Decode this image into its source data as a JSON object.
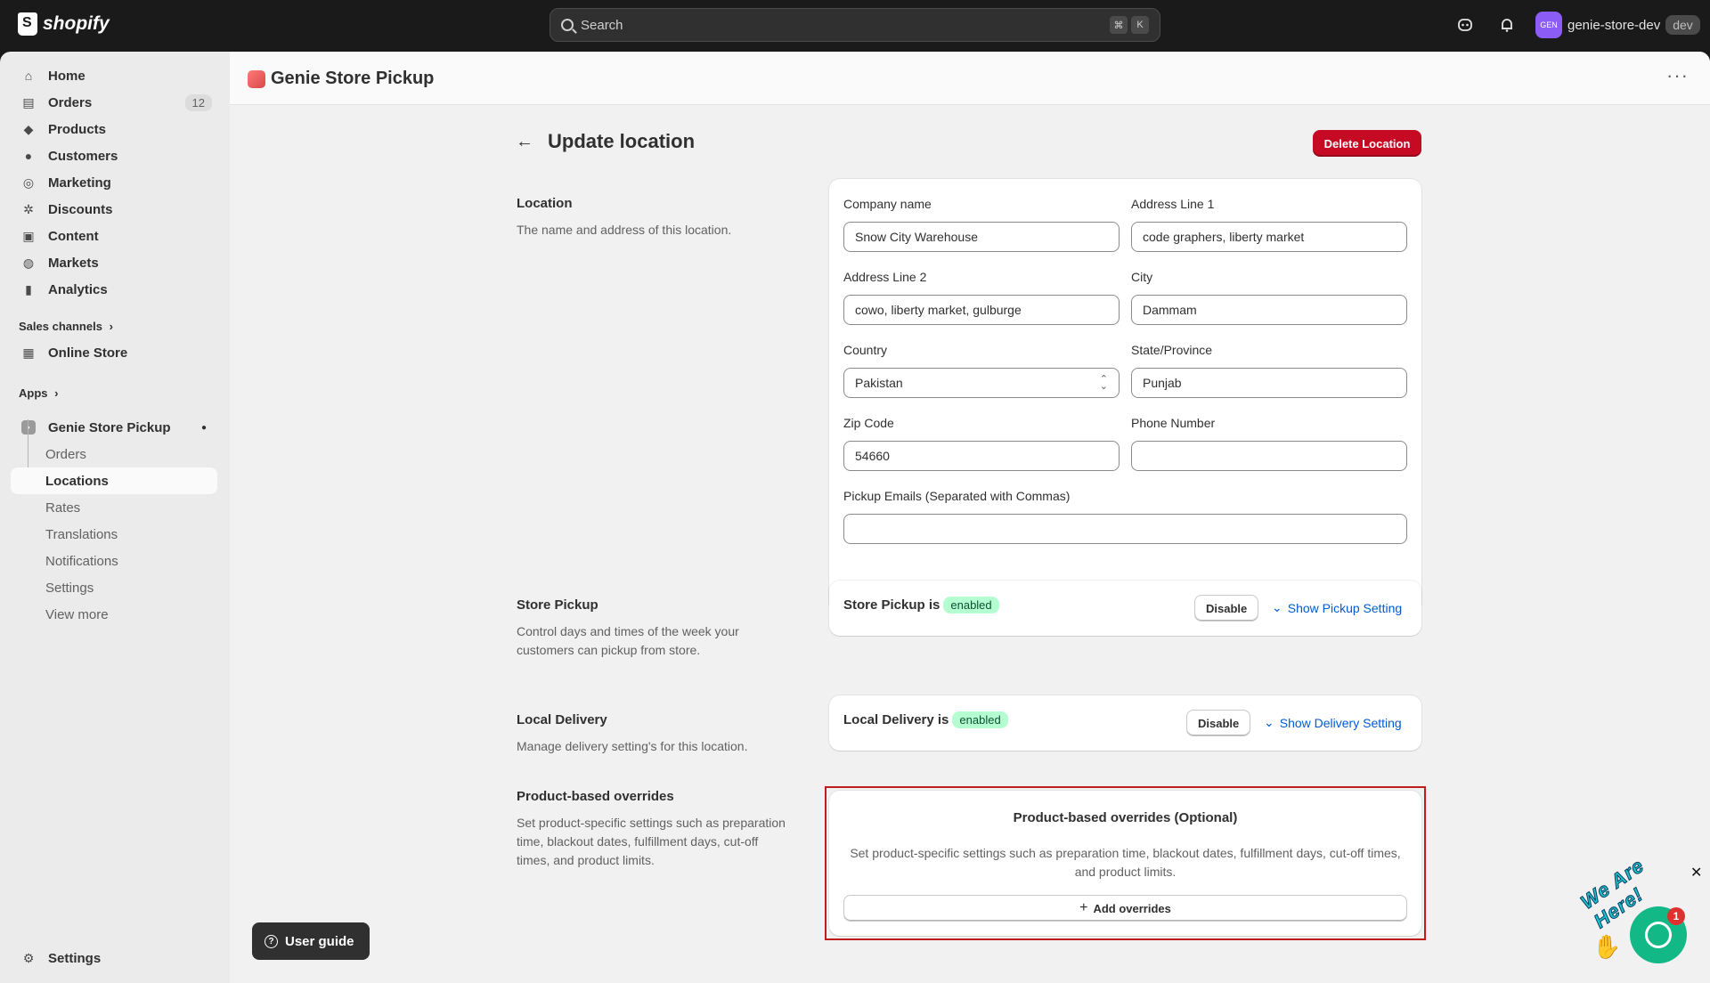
{
  "topbar": {
    "brand": "shopify",
    "search_placeholder": "Search",
    "shortcut_keys": [
      "⌘",
      "K"
    ],
    "store_avatar": "GEN",
    "store_name": "genie-store-dev",
    "store_tag": "dev"
  },
  "sidebar": {
    "items": [
      {
        "label": "Home",
        "icon": "home-icon"
      },
      {
        "label": "Orders",
        "icon": "orders-icon",
        "badge": "12"
      },
      {
        "label": "Products",
        "icon": "tag-icon"
      },
      {
        "label": "Customers",
        "icon": "person-icon"
      },
      {
        "label": "Marketing",
        "icon": "target-icon"
      },
      {
        "label": "Discounts",
        "icon": "discount-icon"
      },
      {
        "label": "Content",
        "icon": "content-icon"
      },
      {
        "label": "Markets",
        "icon": "globe-icon"
      },
      {
        "label": "Analytics",
        "icon": "bar-chart-icon"
      }
    ],
    "sales_channels_label": "Sales channels",
    "online_store": "Online Store",
    "apps_label": "Apps",
    "app_name": "Genie Store Pickup",
    "app_subitems": [
      "Orders",
      "Locations",
      "Rates",
      "Translations",
      "Notifications",
      "Settings",
      "View more"
    ],
    "active_subitem": "Locations",
    "settings": "Settings"
  },
  "app_header": {
    "title": "Genie Store Pickup",
    "more": "···"
  },
  "page": {
    "back_arrow": "←",
    "title": "Update location",
    "delete_button": "Delete Location"
  },
  "location_section": {
    "title": "Location",
    "description": "The name and address of this location.",
    "fields": {
      "company_name": {
        "label": "Company name",
        "value": "Snow City Warehouse"
      },
      "address1": {
        "label": "Address Line 1",
        "value": "code graphers, liberty market"
      },
      "address2": {
        "label": "Address Line 2",
        "value": "cowo, liberty market, gulburge"
      },
      "city": {
        "label": "City",
        "value": "Dammam"
      },
      "country": {
        "label": "Country",
        "value": "Pakistan"
      },
      "state": {
        "label": "State/Province",
        "value": "Punjab"
      },
      "zip": {
        "label": "Zip Code",
        "value": "54660"
      },
      "phone": {
        "label": "Phone Number",
        "value": ""
      },
      "pickup_emails": {
        "label": "Pickup Emails (Separated with Commas)",
        "value": ""
      }
    }
  },
  "store_pickup": {
    "title": "Store Pickup",
    "description": "Control days and times of the week your customers can pickup from store.",
    "status_prefix": "Store Pickup is",
    "status": "enabled",
    "disable_button": "Disable",
    "show_link": "Show Pickup Setting"
  },
  "local_delivery": {
    "title": "Local Delivery",
    "description": "Manage delivery setting's for this location.",
    "status_prefix": "Local Delivery is",
    "status": "enabled",
    "disable_button": "Disable",
    "show_link": "Show Delivery Setting"
  },
  "overrides": {
    "title": "Product-based overrides",
    "description": "Set product-specific settings such as preparation time, blackout dates, fulfillment days, cut-off times, and product limits.",
    "card_title": "Product-based overrides (Optional)",
    "card_description": "Set product-specific settings such as preparation time, blackout dates, fulfillment days, cut-off times, and product limits.",
    "add_button": "Add overrides"
  },
  "user_guide": "User guide",
  "chat": {
    "text": "We Are Here!",
    "count": "1",
    "close": "✕"
  },
  "colors": {
    "topbar": "#1a1a1a",
    "delete": "#c70a24",
    "enabled_pill": "#b4fed2",
    "link": "#005bd3",
    "highlight_frame": "#c01c1c"
  }
}
